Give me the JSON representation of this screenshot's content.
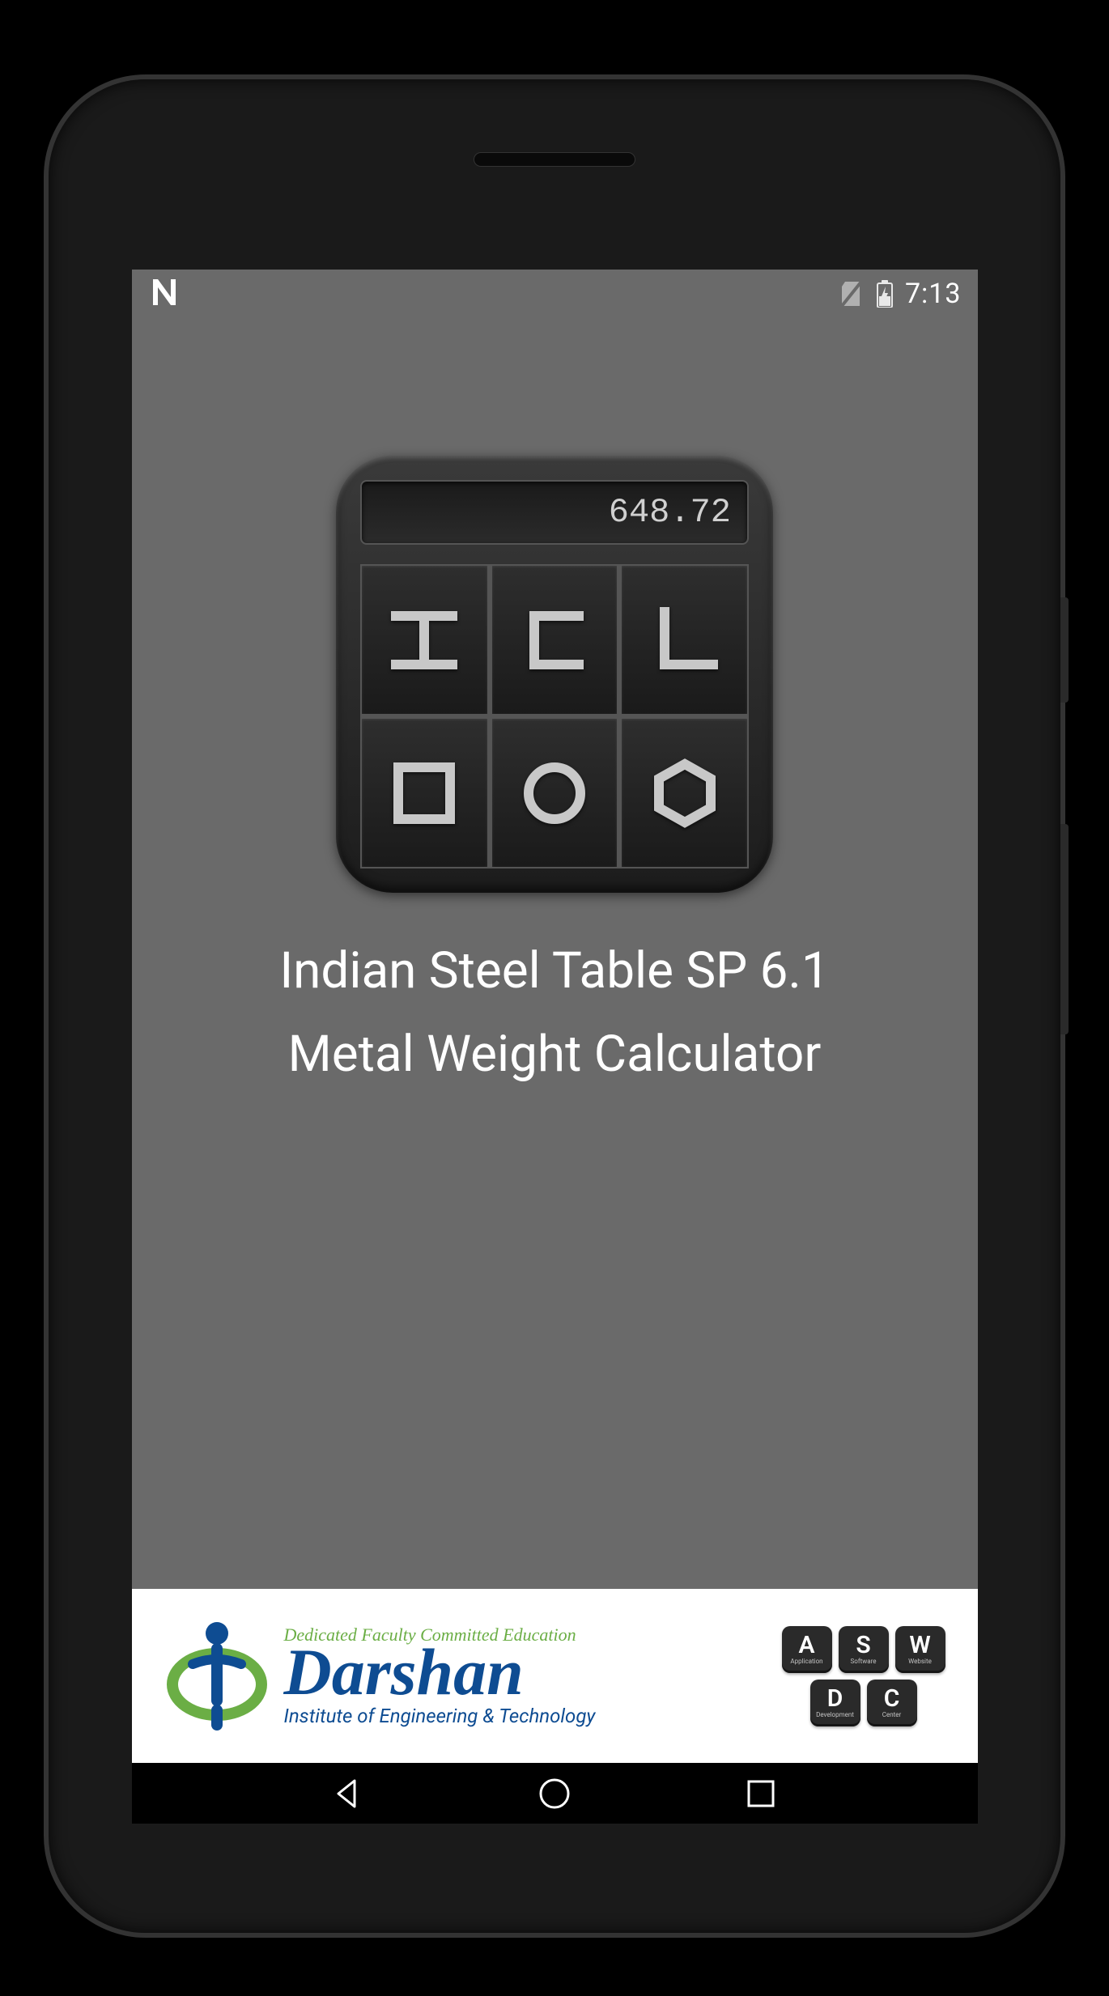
{
  "status": {
    "time": "7:13"
  },
  "app_icon": {
    "display_value": "648.72"
  },
  "titles": {
    "line1": "Indian Steel Table SP 6.1",
    "line2": "Metal Weight Calculator"
  },
  "footer": {
    "tagline": "Dedicated Faculty Committed Education",
    "org_name": "Darshan",
    "org_sub": "Institute of Engineering & Technology",
    "keys": {
      "a": "A",
      "a_label": "Application",
      "s": "S",
      "s_label": "Software",
      "w": "W",
      "w_label": "Website",
      "d": "D",
      "d_label": "Development",
      "c": "C",
      "c_label": "Center"
    }
  }
}
